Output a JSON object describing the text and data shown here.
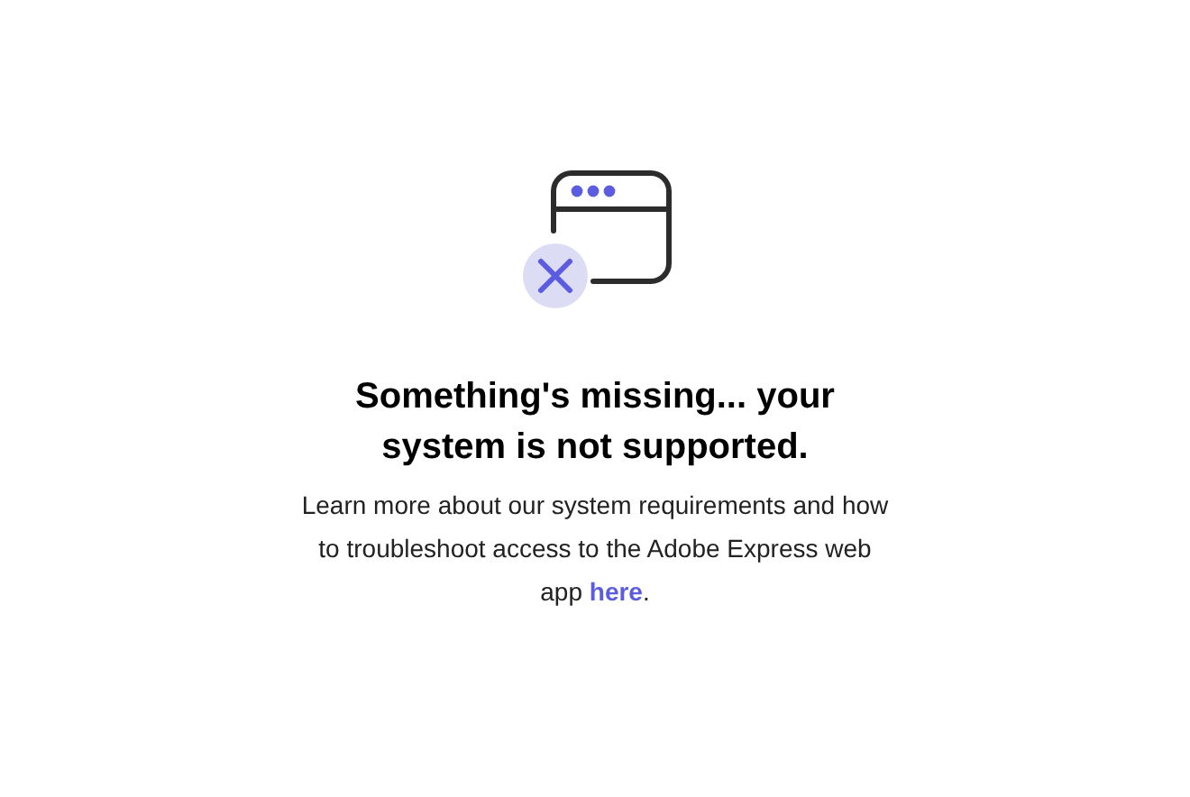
{
  "title": "Something's missing... your system is not supported.",
  "message": {
    "text": "Learn more about our system requirements and how to troubleshoot access to the Adobe Express web app ",
    "link": "here",
    "end": "."
  }
}
